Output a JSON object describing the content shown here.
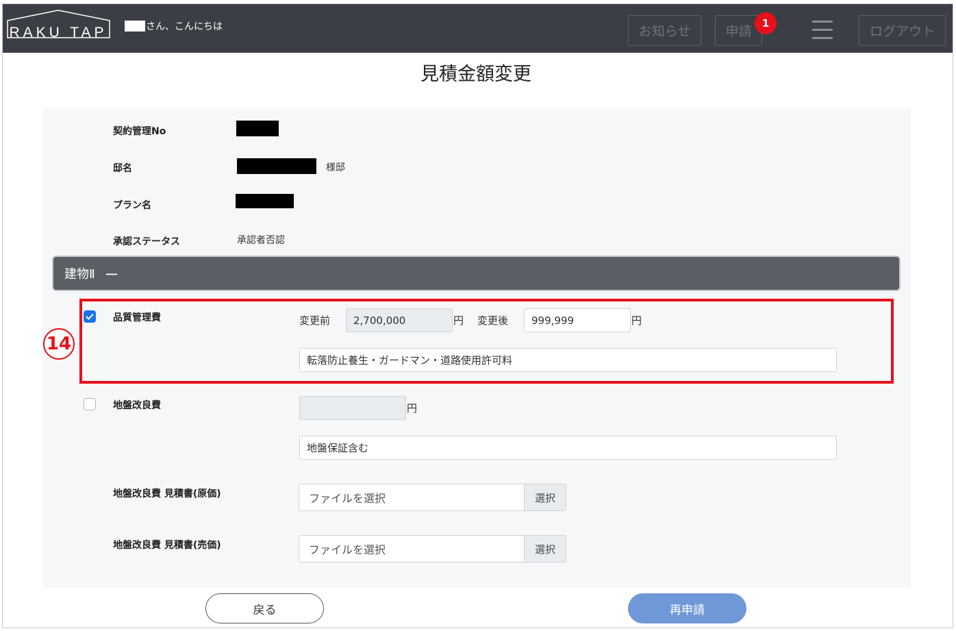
{
  "header": {
    "logo_text": "RAKU TAP",
    "greeting": "さん、こんにちは",
    "news_label": "お知らせ",
    "apply_label": "申請",
    "apply_badge": "1",
    "logout_label": "ログアウト",
    "menu_icon": "hamburger-icon"
  },
  "page": {
    "title": "見積金額変更"
  },
  "info": {
    "contract_no_label": "契約管理No",
    "name_label": "邸名",
    "name_suffix": "様邸",
    "plan_label": "プラン名",
    "status_label": "承認ステータス",
    "status_value": "承認者否認"
  },
  "section": {
    "title": "建物Ⅱ",
    "toggle": "ー"
  },
  "annotation": {
    "number": "14"
  },
  "quality": {
    "label": "品質管理費",
    "checked": true,
    "before_label": "変更前",
    "before_value": "2,700,000",
    "unit": "円",
    "after_label": "変更後",
    "after_value": "999,999",
    "note": "転落防止養生・ガードマン・道路使用許可料"
  },
  "ground": {
    "label": "地盤改良費",
    "checked": false,
    "value": "",
    "unit": "円",
    "note": "地盤保証含む"
  },
  "files": [
    {
      "label": "地盤改良費 見積書(原価)",
      "placeholder": "ファイルを選択",
      "button": "選択"
    },
    {
      "label": "地盤改良費 見積書(売価)",
      "placeholder": "ファイルを選択",
      "button": "選択"
    }
  ],
  "actions": {
    "back_label": "戻る",
    "reapply_label": "再申請"
  },
  "colors": {
    "header_bg": "#3b3f45",
    "highlight": "#e8101a",
    "primary": "#6f98d8",
    "checkbox": "#1a73e8"
  }
}
